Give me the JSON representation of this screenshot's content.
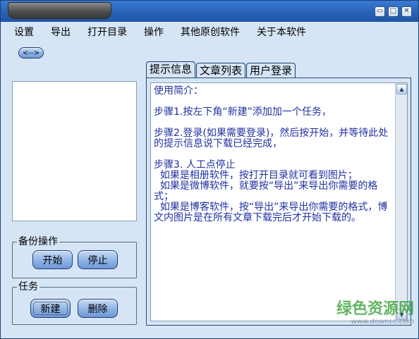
{
  "window": {
    "title": "",
    "controls": {
      "minimize": "▭",
      "maximize": "□",
      "close": "✕"
    }
  },
  "menu": {
    "items": [
      "设置",
      "导出",
      "打开目录",
      "操作",
      "其他原创软件",
      "关于本软件"
    ]
  },
  "toolbar": {
    "toggle_label": "<-->"
  },
  "backup_group": {
    "label": "备份操作",
    "start_label": "开始",
    "stop_label": "停止"
  },
  "task_group": {
    "label": "任务",
    "new_label": "新建",
    "delete_label": "删除"
  },
  "tabs": [
    {
      "label": "提示信息",
      "active": true
    },
    {
      "label": "文章列表",
      "active": false
    },
    {
      "label": "用户登录",
      "active": false
    }
  ],
  "info_text": "使用简介：\n\n步骤1.按左下角“新建”添加加一个任务，\n\n步骤2.登录(如果需要登录)，然后按开始，并等待此处的提示信息说下载已经完成，\n\n步骤3. 人工点停止\n  如果是相册软件，按打开目录就可看到图片；\n  如果是微博软件，就要按“导出”来导出你需要的格式；\n  如果是博客软件，按“导出”来导出你需要的格式，博文内图片是在所有文章下载完后才开始下载的。",
  "watermark": {
    "logo": "绿色资源网",
    "url": "www.downcc.com"
  },
  "colors": {
    "window_bg": "#d6e5f5",
    "titlebar": "#2a62b8",
    "info_text": "#2030a0",
    "watermark_green": "#3ca33c"
  },
  "icons": {
    "scroll_up": "scroll-up-arrow-icon",
    "scroll_down": "scroll-down-arrow-icon"
  }
}
